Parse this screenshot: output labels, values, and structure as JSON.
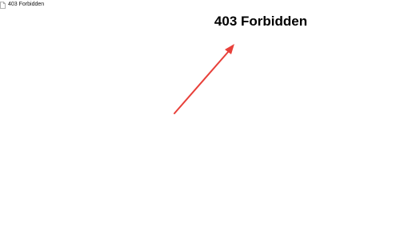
{
  "tab": {
    "title": "403 Forbidden",
    "icon": "document-icon"
  },
  "main": {
    "heading": "403 Forbidden"
  },
  "annotation": {
    "icon": "arrow-icon",
    "color": "#e8403a"
  }
}
